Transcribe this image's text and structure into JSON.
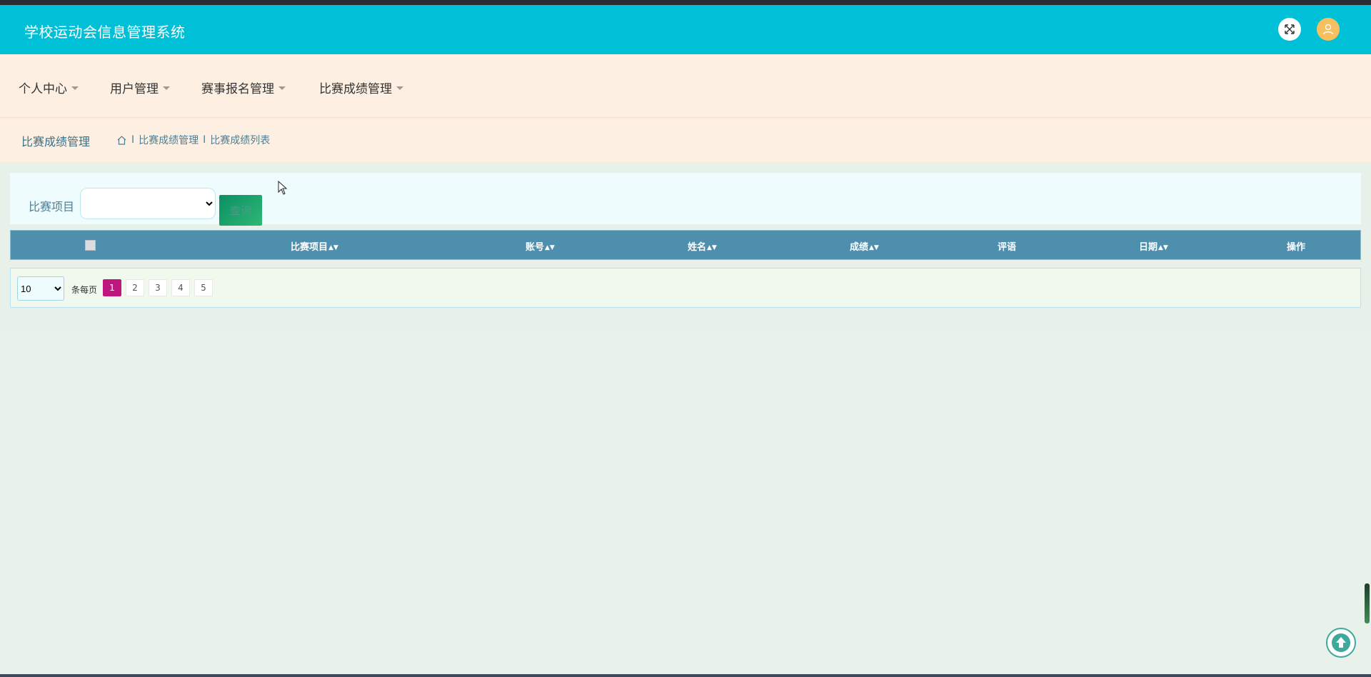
{
  "app": {
    "title": "学校运动会信息管理系统"
  },
  "nav": {
    "items": [
      {
        "label": "个人中心"
      },
      {
        "label": "用户管理"
      },
      {
        "label": "赛事报名管理"
      },
      {
        "label": "比赛成绩管理"
      }
    ]
  },
  "breadcrumb": {
    "page_name": "比赛成绩管理",
    "home_icon": "home-icon",
    "items": [
      "比赛成绩管理",
      "比赛成绩列表"
    ],
    "separator": "I"
  },
  "search": {
    "label": "比赛项目",
    "select_value": "",
    "button_label": "查询"
  },
  "table": {
    "columns": [
      {
        "label": "比赛项目",
        "sortable": true
      },
      {
        "label": "账号",
        "sortable": true
      },
      {
        "label": "姓名",
        "sortable": true
      },
      {
        "label": "成绩",
        "sortable": true
      },
      {
        "label": "评语",
        "sortable": false
      },
      {
        "label": "日期",
        "sortable": true
      },
      {
        "label": "操作",
        "sortable": false
      }
    ],
    "rows": []
  },
  "pagination": {
    "page_size": "10",
    "page_size_options": [
      "10"
    ],
    "per_page_label": "条每页",
    "pages": [
      "1",
      "2",
      "3",
      "4",
      "5"
    ],
    "current_page": "1"
  },
  "colors": {
    "header_bg": "#00c0d8",
    "nav_bg": "#fdf0e2",
    "table_head_bg": "#4f8fae",
    "active_page": "#c0177e",
    "query_button": "#1aa46c"
  }
}
